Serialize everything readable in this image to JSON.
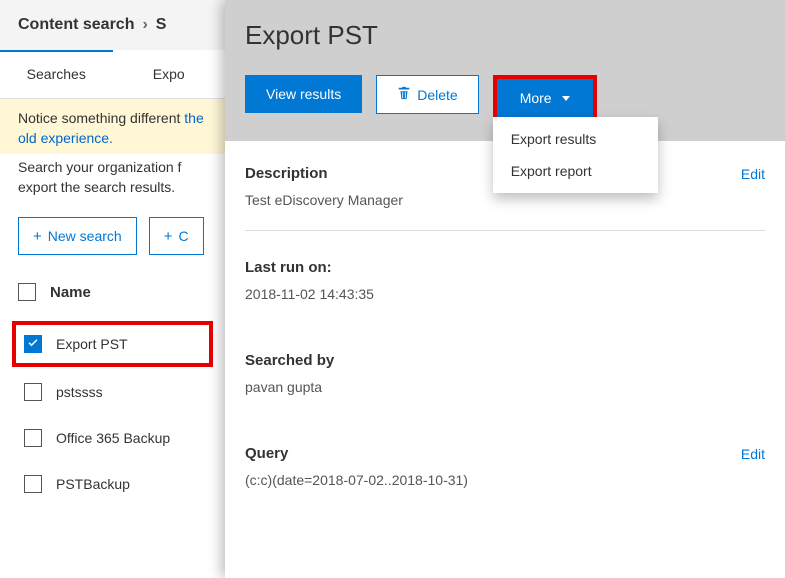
{
  "crumb": {
    "root": "Content search",
    "chev": "›",
    "tail": "S"
  },
  "tabs": {
    "searches": "Searches",
    "exports": "Expo"
  },
  "notice": {
    "line1": "Notice something different",
    "link": "the old experience."
  },
  "intro": "Search your organization f\nexport the search results.",
  "buttons": {
    "new_search": "New search",
    "plus2": "C"
  },
  "list": {
    "header": "Name",
    "rows": [
      "Export PST",
      "pstssss",
      "Office 365 Backup",
      "PSTBackup"
    ]
  },
  "panel": {
    "title": "Export PST",
    "actions": {
      "view": "View results",
      "delete": "Delete",
      "more": "More"
    },
    "menu": {
      "results": "Export results",
      "report": "Export report"
    },
    "edit": "Edit",
    "description": {
      "label": "Description",
      "value": "Test eDiscovery Manager"
    },
    "lastrun": {
      "label": "Last run on:",
      "value": "2018-11-02 14:43:35"
    },
    "searchedby": {
      "label": "Searched by",
      "value": "pavan gupta"
    },
    "query": {
      "label": "Query",
      "value": "(c:c)(date=2018-07-02..2018-10-31)"
    }
  }
}
